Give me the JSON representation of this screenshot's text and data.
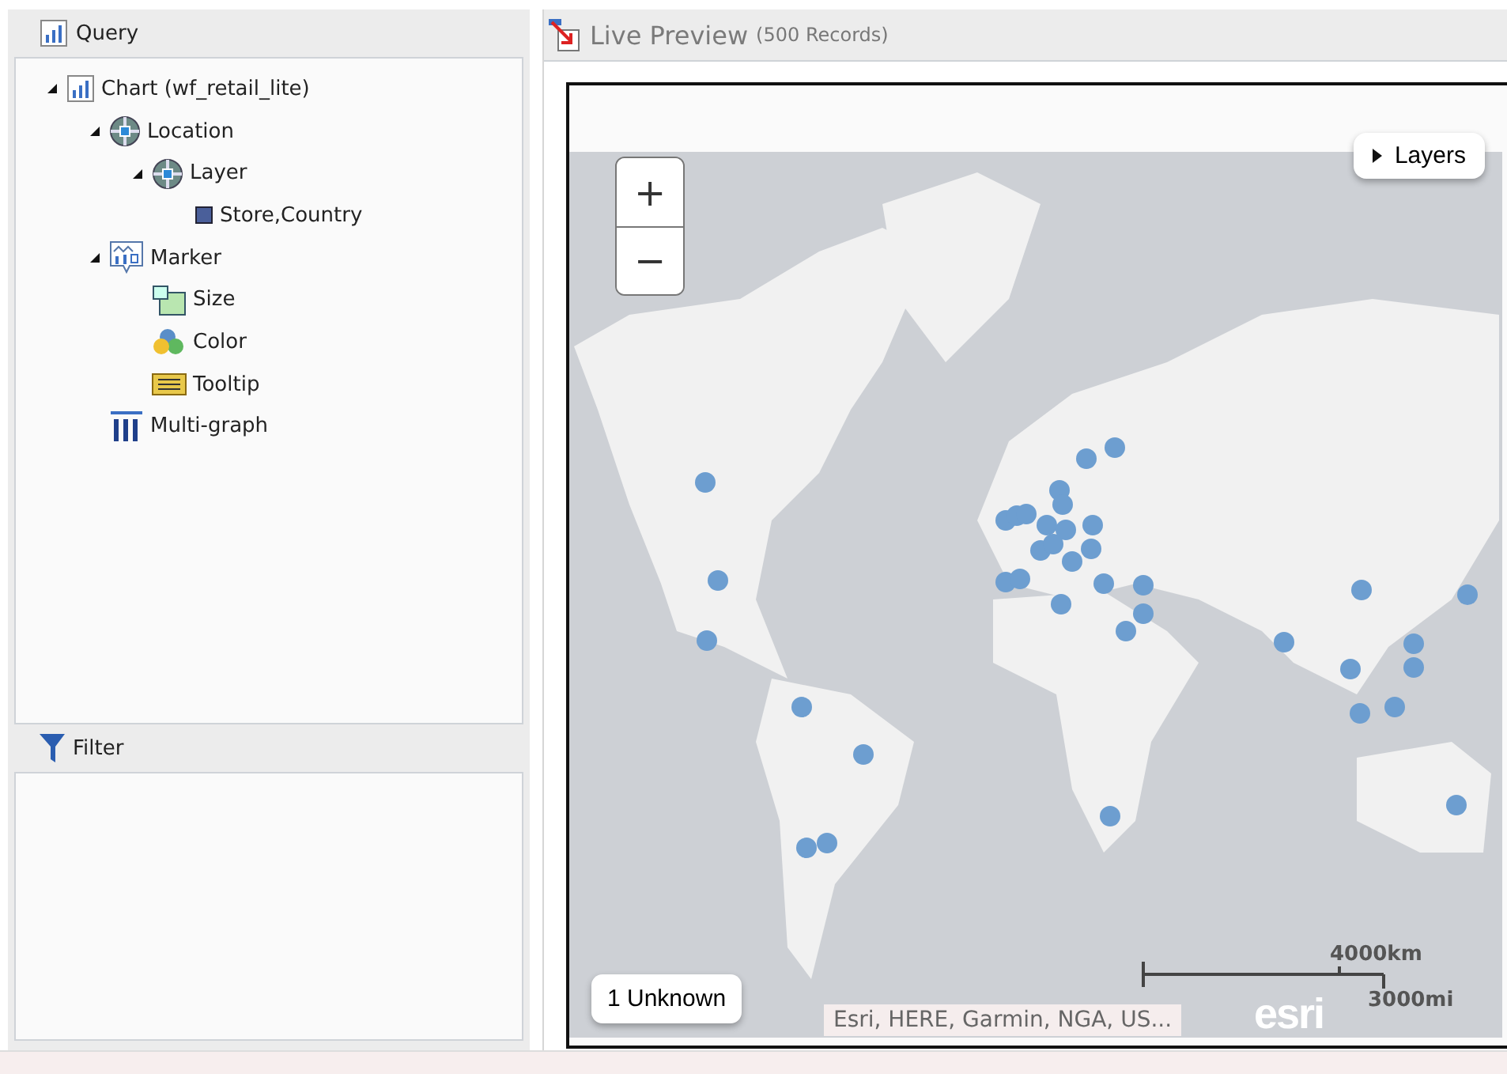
{
  "query_panel": {
    "title": "Query",
    "tree": [
      {
        "label": "Chart (wf_retail_lite)",
        "kind": "chart",
        "expanded": true,
        "children": [
          {
            "label": "Location",
            "kind": "location",
            "expanded": true,
            "children": [
              {
                "label": "Layer",
                "kind": "location",
                "expanded": true,
                "children": [
                  {
                    "label": "Store,Country",
                    "kind": "field"
                  }
                ]
              }
            ]
          },
          {
            "label": "Marker",
            "kind": "marker",
            "expanded": true,
            "children": [
              {
                "label": "Size",
                "kind": "size"
              },
              {
                "label": "Color",
                "kind": "color"
              },
              {
                "label": "Tooltip",
                "kind": "tooltip"
              }
            ]
          },
          {
            "label": "Multi-graph",
            "kind": "multigraph"
          }
        ]
      }
    ]
  },
  "filter_panel": {
    "title": "Filter"
  },
  "preview": {
    "title": "Live Preview",
    "record_count": "(500 Records)",
    "map": {
      "zoom_in": "+",
      "zoom_out": "−",
      "layers_button": "Layers",
      "unknown_badge": "1 Unknown",
      "scale_km": "4000km",
      "scale_mi": "3000mi",
      "attribution": "Esri, HERE, Garmin, NGA, US...",
      "logo": "esri"
    }
  }
}
